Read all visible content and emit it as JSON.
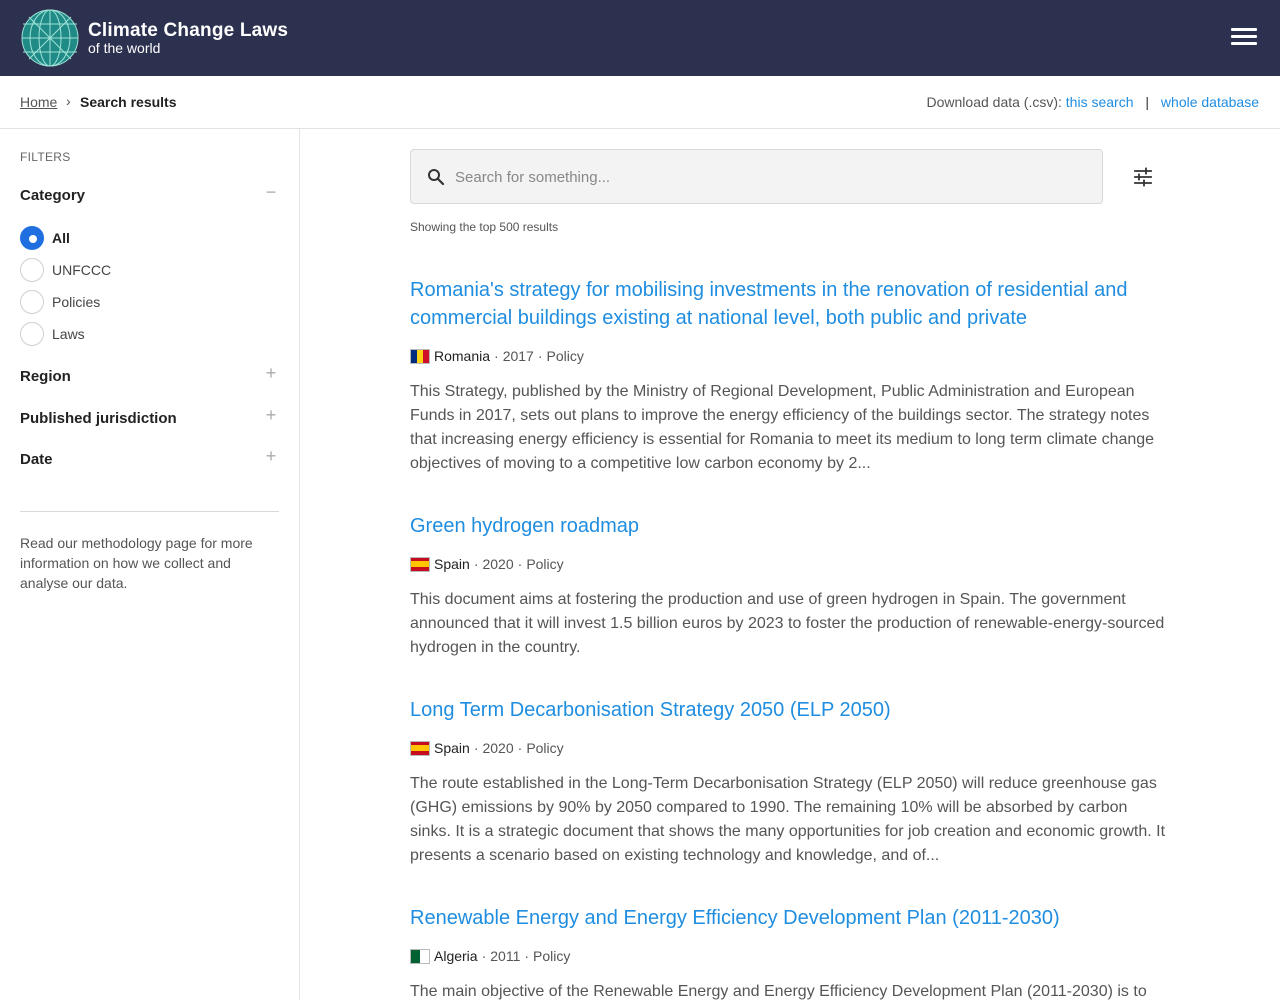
{
  "header": {
    "brand_title": "Climate Change Laws",
    "brand_subtitle": "of the world"
  },
  "breadcrumb": {
    "home": "Home",
    "separator": "›",
    "current": "Search results"
  },
  "download": {
    "label": "Download data (.csv):",
    "this_search": "this search",
    "divider": "|",
    "whole_database": "whole database"
  },
  "sidebar": {
    "filters_label": "FILTERS",
    "category": {
      "title": "Category",
      "toggle": "−",
      "options": [
        "All",
        "UNFCCC",
        "Policies",
        "Laws"
      ],
      "selected": "All"
    },
    "groups": [
      {
        "title": "Region",
        "toggle": "+"
      },
      {
        "title": "Published jurisdiction",
        "toggle": "+"
      },
      {
        "title": "Date",
        "toggle": "+"
      }
    ],
    "methodology_text": "Read our methodology page for more information on how we collect and analyse our data."
  },
  "search": {
    "placeholder": "Search for something...",
    "value": ""
  },
  "results_summary": "Showing the top 500 results",
  "results": [
    {
      "title": "Romania's strategy for mobilising investments in the renovation of residential and commercial buildings existing at national level, both public and private",
      "country": "Romania",
      "year": "2017",
      "type": "Policy",
      "flag_colors": [
        "#002b7f",
        "#fcd116",
        "#ce1126"
      ],
      "description": "This Strategy, published by the Ministry of Regional Development, Public Administration and European Funds in 2017, sets out plans to improve the energy efficiency of the buildings sector. The strategy notes that increasing energy efficiency is essential for Romania to meet its medium to long term climate change objectives of moving to a competitive low carbon economy by 2..."
    },
    {
      "title": "Green hydrogen roadmap",
      "country": "Spain",
      "year": "2020",
      "type": "Policy",
      "flag_colors": [
        "#c60b1e",
        "#ffc400",
        "#c60b1e"
      ],
      "description": "This document aims at fostering the production and use of green hydrogen in Spain. The government announced that it will invest 1.5 billion euros by 2023 to foster the production of renewable-energy-sourced hydrogen in the country."
    },
    {
      "title": "Long Term Decarbonisation Strategy 2050 (ELP 2050)",
      "country": "Spain",
      "year": "2020",
      "type": "Policy",
      "flag_colors": [
        "#c60b1e",
        "#ffc400",
        "#c60b1e"
      ],
      "description": "The route established in the Long-Term Decarbonisation Strategy (ELP 2050) will reduce greenhouse gas (GHG) emissions by 90% by 2050 compared to 1990. The remaining 10% will be absorbed by carbon sinks. It is a strategic document that shows the many opportunities for job creation and economic growth. It presents a scenario based on existing technology and knowledge, and of..."
    },
    {
      "title": "Renewable Energy and Energy Efficiency Development Plan (2011-2030)",
      "country": "Algeria",
      "year": "2011",
      "type": "Policy",
      "flag_colors": [
        "#006233",
        "#ffffff"
      ],
      "description": "The main objective of the Renewable Energy and Energy Efficiency Development Plan (2011-2030) is to"
    }
  ],
  "meta_separator": "·",
  "colors": {
    "header_bg": "#2d3150",
    "link": "#1f8de0",
    "radio_selected": "#1f6fe0"
  },
  "icons": {
    "logo": "globe-logo-icon",
    "menu": "hamburger-menu-icon",
    "search": "search-icon",
    "filters": "tune-sliders-icon"
  }
}
